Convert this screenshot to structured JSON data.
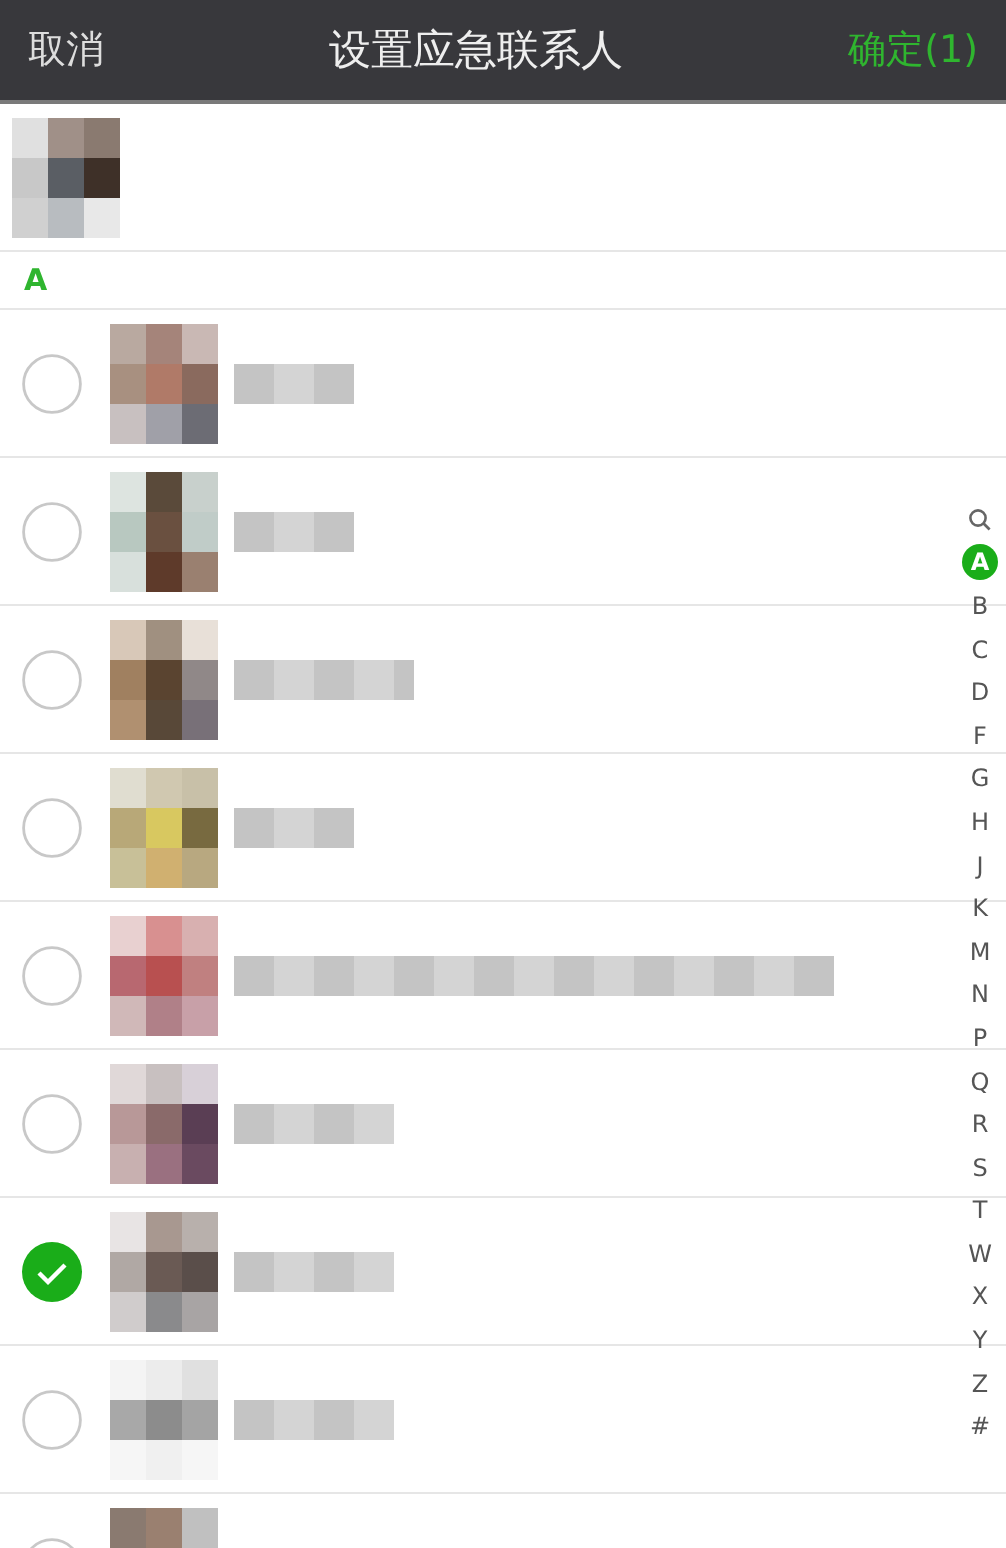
{
  "nav_bar": {
    "cancel": "取消",
    "title": "设置应急联系人",
    "confirm": "确定(1)"
  },
  "section": {
    "letter": "A"
  },
  "contacts": [
    {
      "checked": false
    },
    {
      "checked": false
    },
    {
      "checked": false
    },
    {
      "checked": false
    },
    {
      "checked": false
    },
    {
      "checked": false
    },
    {
      "checked": true
    },
    {
      "checked": false
    },
    {
      "checked": false
    }
  ],
  "index_bar": [
    {
      "kind": "search",
      "selected": false
    },
    {
      "label": "A",
      "selected": true
    },
    {
      "label": "B",
      "selected": false
    },
    {
      "label": "C",
      "selected": false
    },
    {
      "label": "D",
      "selected": false
    },
    {
      "label": "F",
      "selected": false
    },
    {
      "label": "G",
      "selected": false
    },
    {
      "label": "H",
      "selected": false
    },
    {
      "label": "J",
      "selected": false
    },
    {
      "label": "K",
      "selected": false
    },
    {
      "label": "M",
      "selected": false
    },
    {
      "label": "N",
      "selected": false
    },
    {
      "label": "P",
      "selected": false
    },
    {
      "label": "Q",
      "selected": false
    },
    {
      "label": "R",
      "selected": false
    },
    {
      "label": "S",
      "selected": false
    },
    {
      "label": "T",
      "selected": false
    },
    {
      "label": "W",
      "selected": false
    },
    {
      "label": "X",
      "selected": false
    },
    {
      "label": "Y",
      "selected": false
    },
    {
      "label": "Z",
      "selected": false
    },
    {
      "label": "#",
      "selected": false
    }
  ]
}
